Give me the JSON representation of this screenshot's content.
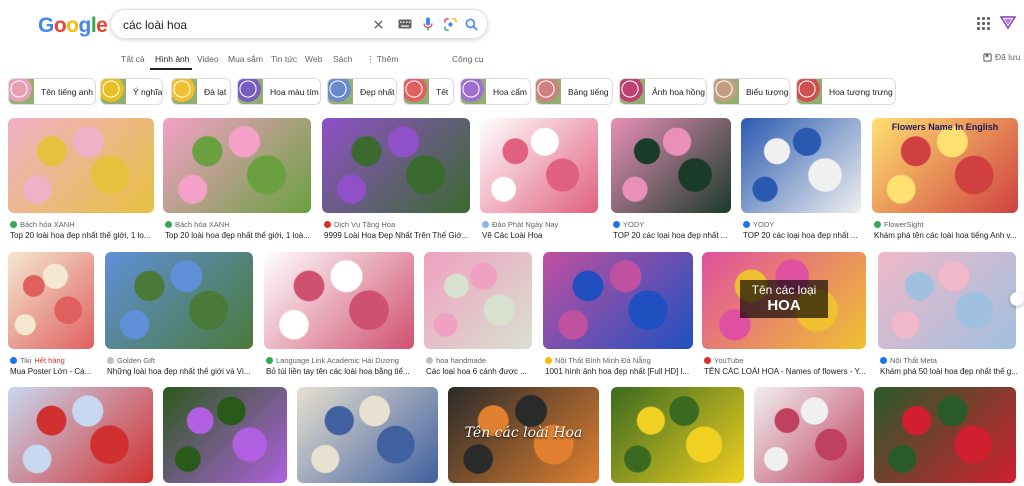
{
  "colors": {
    "blue": "#4285F4",
    "red": "#EA4335",
    "yellow": "#FBBC05",
    "green": "#34A853",
    "text": "#202124",
    "muted": "#5f6368"
  },
  "logo": {
    "letters": [
      "G",
      "o",
      "o",
      "g",
      "l",
      "e"
    ]
  },
  "search": {
    "query": "các loài hoa",
    "icons": [
      "clear-icon",
      "keyboard-icon",
      "mic-icon",
      "lens-icon",
      "search-icon"
    ]
  },
  "tabs": [
    {
      "label": "Tất cả"
    },
    {
      "label": "Hình ảnh",
      "active": true
    },
    {
      "label": "Video"
    },
    {
      "label": "Mua sắm"
    },
    {
      "label": "Tin tức"
    },
    {
      "label": "Web"
    },
    {
      "label": "Sách"
    },
    {
      "label": "⋮ Thêm"
    },
    {
      "label": "Công cụ"
    }
  ],
  "saved": {
    "label": "Đã lưu"
  },
  "chips": [
    {
      "label": "Tên tiếng anh",
      "color": "#e8a0b4"
    },
    {
      "label": "Ý nghĩa",
      "color": "#e8c020"
    },
    {
      "label": "Đà lạt",
      "color": "#f0c030"
    },
    {
      "label": "Hoa màu tím",
      "color": "#7a5cc0"
    },
    {
      "label": "Đẹp nhất",
      "color": "#6a8ad0"
    },
    {
      "label": "Tết",
      "color": "#e06060"
    },
    {
      "label": "Hoa cẩm",
      "color": "#a070d0"
    },
    {
      "label": "Bảng tiếng",
      "color": "#d08080"
    },
    {
      "label": "Ảnh hoa hồng",
      "color": "#c04070"
    },
    {
      "label": "Biểu tượng",
      "color": "#c0a080"
    },
    {
      "label": "Hoa tượng trưng",
      "color": "#d05050"
    }
  ],
  "row1": [
    {
      "source": "Bách hóa XANH",
      "title": "Top 20 loài hoa đẹp nhất thế giới, 1 lo...",
      "c1": "#f0b0c8",
      "c2": "#e8c040",
      "dot": "#34A853"
    },
    {
      "source": "Bách hóa XANH",
      "title": "Top 20 loài hoa đẹp nhất thế giới, 1 loà...",
      "c1": "#f5a0c8",
      "c2": "#6aa040",
      "dot": "#34A853"
    },
    {
      "source": "Dịch Vụ Tặng Hoa",
      "title": "9999 Loài Hoa Đẹp Nhất Trên Thế Giớ...",
      "c1": "#9050c8",
      "c2": "#3a6a30",
      "dot": "#d93025"
    },
    {
      "source": "Đảo Phát Ngày Nay",
      "title": "Vẽ Các Loài Hoa",
      "c1": "#ffffff",
      "c2": "#e06080",
      "dot": "#8ab4f8"
    },
    {
      "source": "YODY",
      "title": "TOP 20 các loại hoa đẹp nhất ...",
      "c1": "#e890b8",
      "c2": "#1a3a2a",
      "dot": "#1a73e8"
    },
    {
      "source": "YODY",
      "title": "TOP 20 các loại hoa đẹp nhất ...",
      "c1": "#2a5ab0",
      "c2": "#f0f0f0",
      "dot": "#1a73e8"
    },
    {
      "source": "FlowerSight",
      "title": "Khám phá tên các loài hoa tiếng Anh v...",
      "c1": "#ffe070",
      "c2": "#d04040",
      "dot": "#34A853",
      "banner": "Flowers Name In English"
    }
  ],
  "row2": [
    {
      "source": "Tiki",
      "hot": "Hết hàng",
      "title": "Mua Poster Lớn - Cá...",
      "c1": "#f4e8d0",
      "c2": "#e06060",
      "dot": "#1a73e8"
    },
    {
      "source": "Golden Gift",
      "title": "Những loài hoa đẹp nhất thế giới và Vi...",
      "c1": "#6090d8",
      "c2": "#4a7a3a",
      "dot": "#bdc1c6"
    },
    {
      "source": "Language Link Academic Hải Dương",
      "title": "Bỏ túi liền tay tên các loài hoa bằng tiế...",
      "c1": "#ffffff",
      "c2": "#d05070",
      "dot": "#34A853"
    },
    {
      "source": "hoa handmade",
      "title": "Các loại hoa 6 cánh được ...",
      "c1": "#f0a0c0",
      "c2": "#d8e0d0",
      "dot": "#bdc1c6"
    },
    {
      "source": "Nội Thất Bình Minh Đà Nẵng",
      "title": "1001 hình ảnh hoa đẹp nhất [Full HD] l...",
      "c1": "#c050a0",
      "c2": "#2050c0",
      "dot": "#fbbc05"
    },
    {
      "source": "YouTube",
      "title": "TÊN CÁC LOÀI HOA - Names of flowers - Y...",
      "c1": "#e050a0",
      "c2": "#f0c030",
      "dot": "#d93025",
      "overlay1": "Tên các loại",
      "overlay2": "HOA"
    },
    {
      "source": "Nội Thất Meta",
      "title": "Khám phá 50 loài hoa đẹp nhất thế g...",
      "c1": "#f0b8c8",
      "c2": "#a0c0e0",
      "dot": "#1a73e8"
    }
  ],
  "row3": [
    {
      "c1": "#c8d8f0",
      "c2": "#d03030"
    },
    {
      "c1": "#2a5a1a",
      "c2": "#b060e0"
    },
    {
      "c1": "#e8e0d0",
      "c2": "#4060a0"
    },
    {
      "c1": "#2a2a2a",
      "c2": "#e08030",
      "caption": "Tên các loài Hoa"
    },
    {
      "c1": "#3a6a20",
      "c2": "#f0d020"
    },
    {
      "c1": "#f0f0f0",
      "c2": "#c04060"
    },
    {
      "c1": "#2a5a2a",
      "c2": "#d02030"
    }
  ]
}
